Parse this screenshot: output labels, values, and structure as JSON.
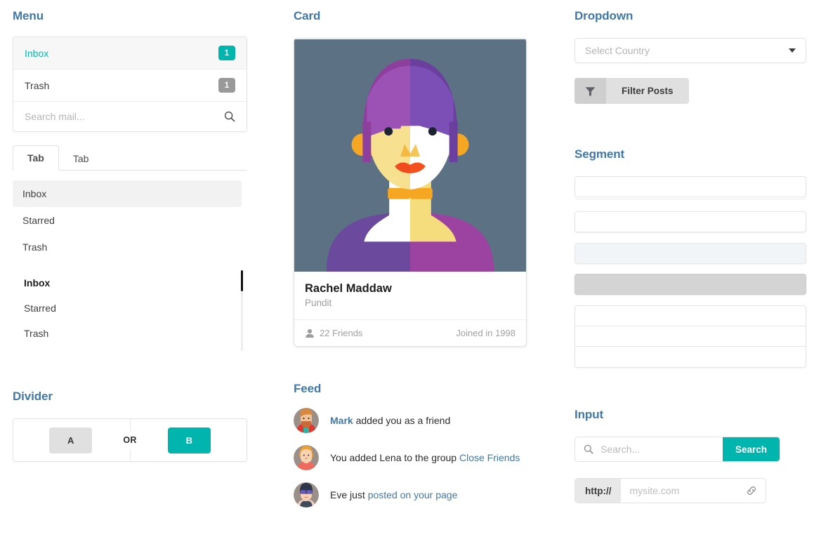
{
  "sections": {
    "menu": "Menu",
    "card": "Card",
    "dropdown": "Dropdown",
    "segment": "Segment",
    "divider": "Divider",
    "feed": "Feed",
    "input": "Input"
  },
  "menu": {
    "items": [
      {
        "label": "Inbox",
        "badge": "1",
        "badge_color": "#00b5ad",
        "active": true
      },
      {
        "label": "Trash",
        "badge": "1",
        "badge_color": "#999999",
        "active": false
      }
    ],
    "search_placeholder": "Search mail...",
    "search_icon": "search-icon",
    "tabs": [
      {
        "label": "Tab",
        "active": true
      },
      {
        "label": "Tab",
        "active": false
      }
    ],
    "list": [
      {
        "label": "Inbox",
        "selected": true
      },
      {
        "label": "Starred",
        "selected": false
      },
      {
        "label": "Trash",
        "selected": false
      }
    ],
    "scroll_list": [
      {
        "label": "Inbox",
        "bold": true
      },
      {
        "label": "Starred",
        "bold": false
      },
      {
        "label": "Trash",
        "bold": false
      }
    ]
  },
  "divider": {
    "button_a": "A",
    "button_b": "B",
    "or_label": "OR",
    "accent": "#00b5ad"
  },
  "card": {
    "title": "Rachel Maddaw",
    "subtitle": "Pundit",
    "friends": "22 Friends",
    "friends_icon": "user-icon",
    "joined": "Joined in 1998",
    "image_bg": "#5d7184"
  },
  "feed": {
    "items": [
      {
        "link": "Mark",
        "link_first": true,
        "text": " added you as a friend",
        "tail": ""
      },
      {
        "link": "Close Friends",
        "link_first": false,
        "text": "You added Lena to the group ",
        "tail": ""
      },
      {
        "link": "posted on your page",
        "link_first": false,
        "text": "Eve just ",
        "tail": ""
      }
    ]
  },
  "dropdown": {
    "placeholder": "Select Country",
    "caret_icon": "chevron-down-icon",
    "filter_label": "Filter Posts",
    "filter_icon": "funnel-icon"
  },
  "segment": {
    "blocks": [
      "raised",
      "plain",
      "secondary",
      "tertiary"
    ],
    "group_rows": 3
  },
  "input": {
    "search_placeholder": "Search...",
    "search_icon": "search-icon",
    "search_button": "Search",
    "url_prefix": "http://",
    "url_placeholder": "mysite.com",
    "link_icon": "link-icon",
    "accent": "#00b5ad"
  }
}
